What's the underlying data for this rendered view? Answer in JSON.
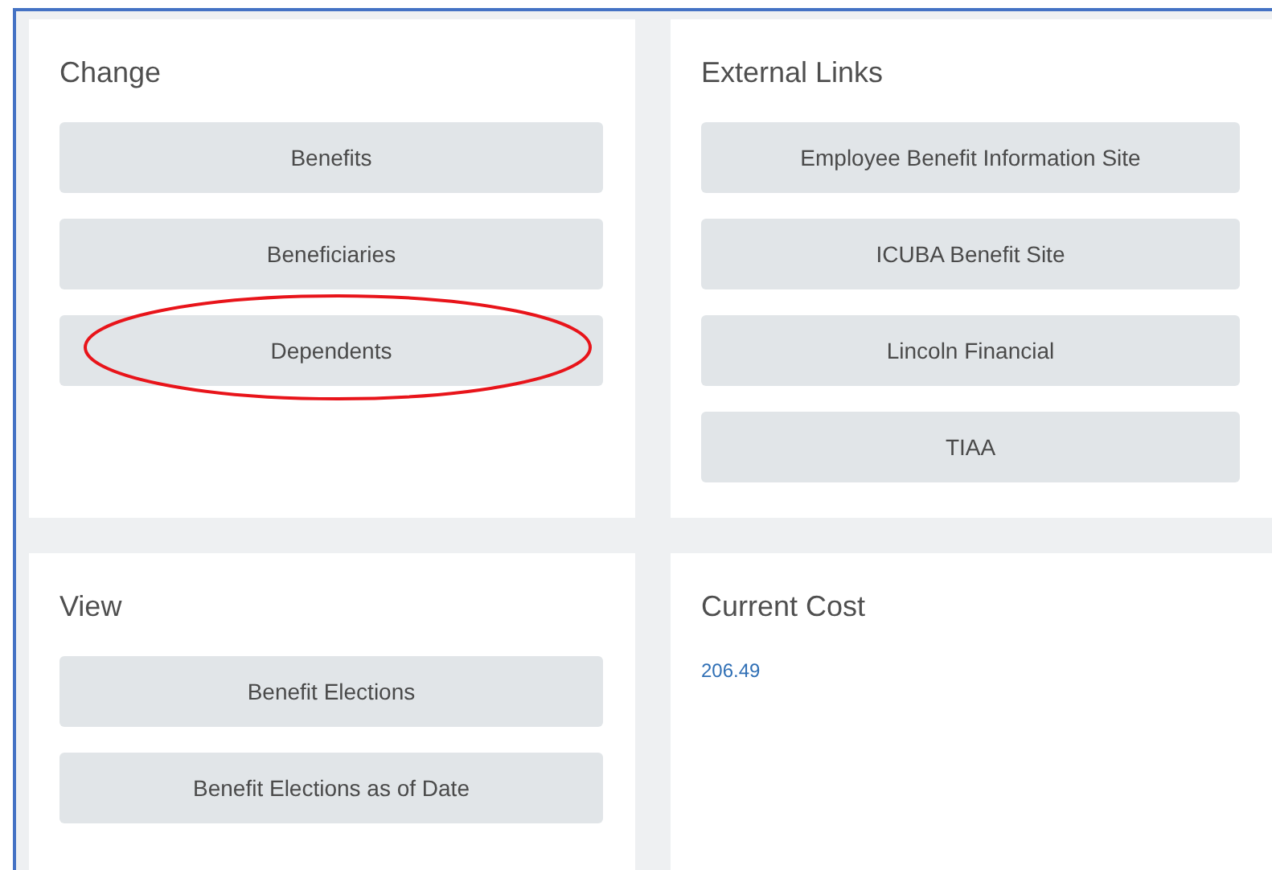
{
  "cards": [
    {
      "title": "Change",
      "kind": "buttons",
      "buttons": [
        {
          "label": "Benefits",
          "highlighted": false
        },
        {
          "label": "Beneficiaries",
          "highlighted": false
        },
        {
          "label": "Dependents",
          "highlighted": true
        }
      ]
    },
    {
      "title": "External Links",
      "kind": "buttons",
      "buttons": [
        {
          "label": "Employee Benefit Information Site",
          "highlighted": false
        },
        {
          "label": "ICUBA Benefit Site",
          "highlighted": false
        },
        {
          "label": "Lincoln Financial",
          "highlighted": false
        },
        {
          "label": "TIAA",
          "highlighted": false
        }
      ]
    },
    {
      "title": "View",
      "kind": "buttons",
      "buttons": [
        {
          "label": "Benefit Elections",
          "highlighted": false
        },
        {
          "label": "Benefit Elections as of Date",
          "highlighted": false
        }
      ]
    },
    {
      "title": "Current Cost",
      "kind": "value",
      "value": "206.49"
    }
  ]
}
